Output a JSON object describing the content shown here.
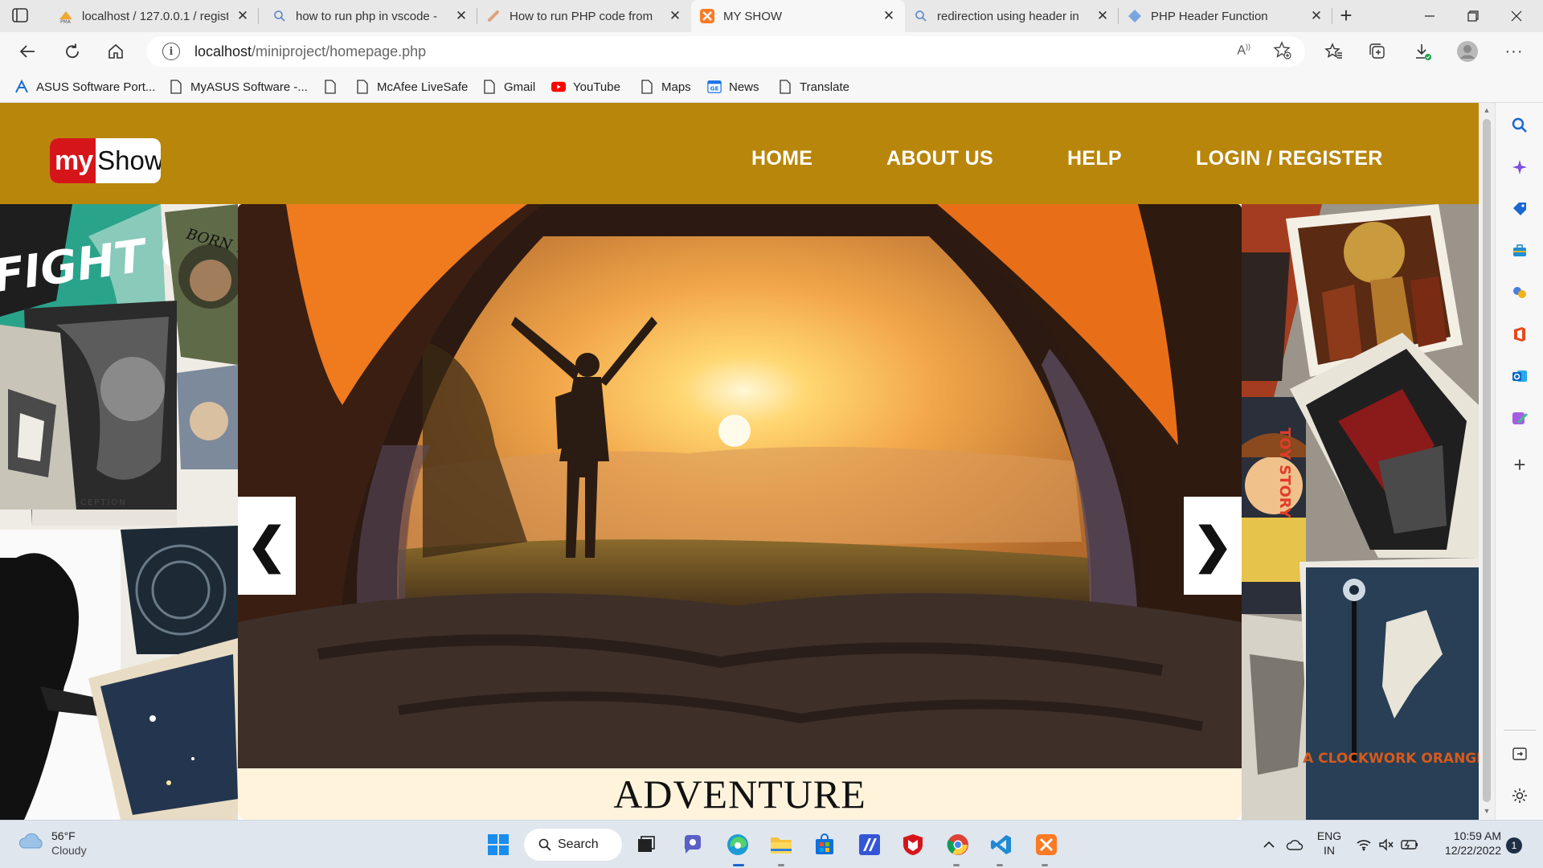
{
  "browser": {
    "tabs": [
      {
        "title": "localhost / 127.0.0.1 / regist",
        "favicon": "pma-icon"
      },
      {
        "title": "how to run php in vscode -",
        "favicon": "search-icon"
      },
      {
        "title": "How to run PHP code from",
        "favicon": "article-icon"
      },
      {
        "title": "MY SHOW",
        "favicon": "xampp-icon",
        "active": true
      },
      {
        "title": "redirection using header in",
        "favicon": "search-icon"
      },
      {
        "title": "PHP Header Function",
        "favicon": "diamond-icon"
      }
    ],
    "address": {
      "host": "localhost",
      "path": "/miniproject/homepage.php"
    },
    "favorites": [
      {
        "label": "ASUS Software Port...",
        "icon": "asus-icon"
      },
      {
        "label": "MyASUS Software -...",
        "icon": "page-icon"
      },
      {
        "label": "",
        "icon": "page-icon"
      },
      {
        "label": "McAfee LiveSafe",
        "icon": "page-icon"
      },
      {
        "label": "Gmail",
        "icon": "page-icon"
      },
      {
        "label": "YouTube",
        "icon": "youtube-icon"
      },
      {
        "label": "Maps",
        "icon": "page-icon"
      },
      {
        "label": "News",
        "icon": "news-icon"
      },
      {
        "label": "Translate",
        "icon": "page-icon"
      }
    ]
  },
  "site": {
    "logo": {
      "my": "my",
      "show": "Show"
    },
    "nav": [
      "HOME",
      "ABOUT US",
      "HELP",
      "LOGIN / REGISTER"
    ],
    "slider": {
      "caption": "ADVENTURE",
      "prev": "❮",
      "next": "❯"
    },
    "posters": {
      "fight_club": "FIGHT CLUB",
      "born_rebel": "BORN TO REBEL",
      "inception": "CEPTION",
      "clockwork": "A CLOCKWORK ORANGE",
      "toy_story": "TOY STORY"
    },
    "colors": {
      "header": "#b8860b",
      "caption_bg": "#fff3dc",
      "logo_red": "#d6151b"
    }
  },
  "taskbar": {
    "weather": {
      "temp": "56°F",
      "cond": "Cloudy"
    },
    "search": "Search",
    "lang": {
      "line1": "ENG",
      "line2": "IN"
    },
    "clock": {
      "time": "10:59 AM",
      "date": "12/22/2022"
    },
    "notification_count": "1"
  }
}
